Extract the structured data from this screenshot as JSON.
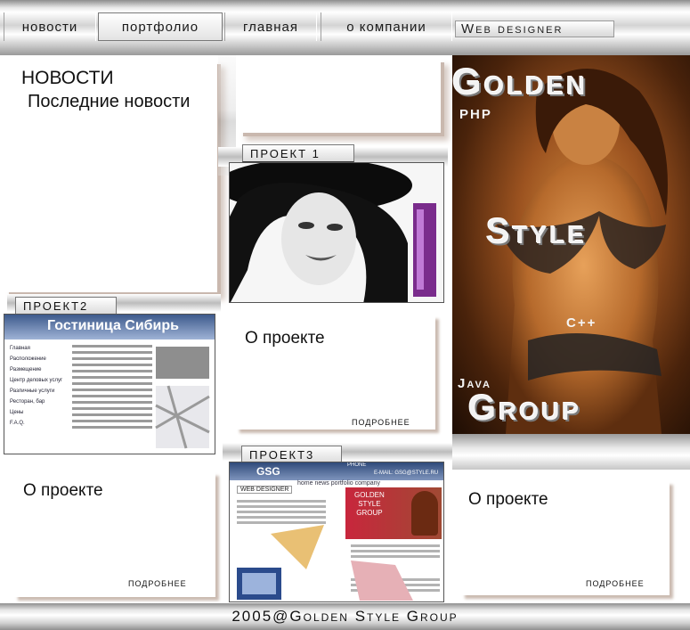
{
  "nav": {
    "items": [
      {
        "label": "новости"
      },
      {
        "label": "портфолио"
      },
      {
        "label": "главная"
      },
      {
        "label": "о компании"
      }
    ]
  },
  "brand_label": "Web designer",
  "news": {
    "heading": "НОВОСТИ",
    "subheading": "Последние новости"
  },
  "projects": [
    {
      "title": "ПРОЕКТ 1",
      "about": "О проекте",
      "more": "ПОДРОБНЕЕ"
    },
    {
      "title": "ПРОЕКТ2",
      "about": "О проекте",
      "more": "ПОДРОБНЕЕ"
    },
    {
      "title": "ПРОЕКТ3",
      "about": "О проекте",
      "more": "ПОДРОБНЕЕ"
    }
  ],
  "thumb2": {
    "header": "Гостиница Сибирь",
    "menu": [
      "Главная",
      "Расположение",
      "Размещение",
      "Центр деловых услуг",
      "Различные услуги",
      "Ресторан, бар",
      "Цены",
      "F.A.Q."
    ]
  },
  "thumb3": {
    "logo": "GSG",
    "phone": "PHONE",
    "email": "E-MAIL: GSG@STYLE.RU",
    "menu": "home  news  portfolio  company",
    "label": "WEB DESIGNER",
    "brand": [
      "GOLDEN",
      "STYLE",
      "GROUP"
    ]
  },
  "hero": {
    "word1": "Golden",
    "word2": "Style",
    "word3": "Group",
    "tag_php": "PHP",
    "tag_cpp": "C++",
    "tag_java": "Java"
  },
  "footer": "2005@Golden Style Group",
  "colors": {
    "hero_bg": "#9c5320",
    "metal": "#cfcfcf"
  }
}
